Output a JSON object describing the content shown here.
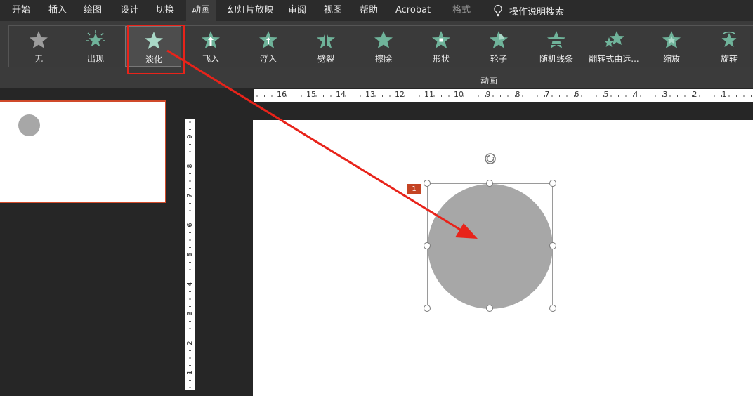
{
  "tabs": [
    {
      "label": "开始"
    },
    {
      "label": "插入"
    },
    {
      "label": "绘图"
    },
    {
      "label": "设计"
    },
    {
      "label": "切换"
    },
    {
      "label": "动画"
    },
    {
      "label": "幻灯片放映"
    },
    {
      "label": "审阅"
    },
    {
      "label": "视图"
    },
    {
      "label": "帮助"
    },
    {
      "label": "Acrobat"
    },
    {
      "label": "格式"
    }
  ],
  "search": {
    "label": "操作说明搜索"
  },
  "animations": [
    {
      "label": "无"
    },
    {
      "label": "出现"
    },
    {
      "label": "淡化"
    },
    {
      "label": "飞入"
    },
    {
      "label": "浮入"
    },
    {
      "label": "劈裂"
    },
    {
      "label": "擦除"
    },
    {
      "label": "形状"
    },
    {
      "label": "轮子"
    },
    {
      "label": "随机线条"
    },
    {
      "label": "翻转式由远..."
    },
    {
      "label": "缩放"
    },
    {
      "label": "旋转"
    }
  ],
  "group_label": "动画",
  "selected_animation": "淡化",
  "ruler_h": [
    "16",
    "15",
    "14",
    "13",
    "12",
    "11",
    "10",
    "9",
    "8",
    "7",
    "6",
    "5",
    "4",
    "3",
    "2",
    "1"
  ],
  "ruler_v": [
    "9",
    "8",
    "7",
    "6",
    "5",
    "4",
    "3",
    "2",
    "1"
  ],
  "shape": {
    "animation_badge": "1"
  },
  "colors": {
    "accent_arrow": "#e8231a",
    "star_green": "#6fb39a",
    "star_gray": "#9a9a9a",
    "shape_fill": "#a7a7a7"
  }
}
